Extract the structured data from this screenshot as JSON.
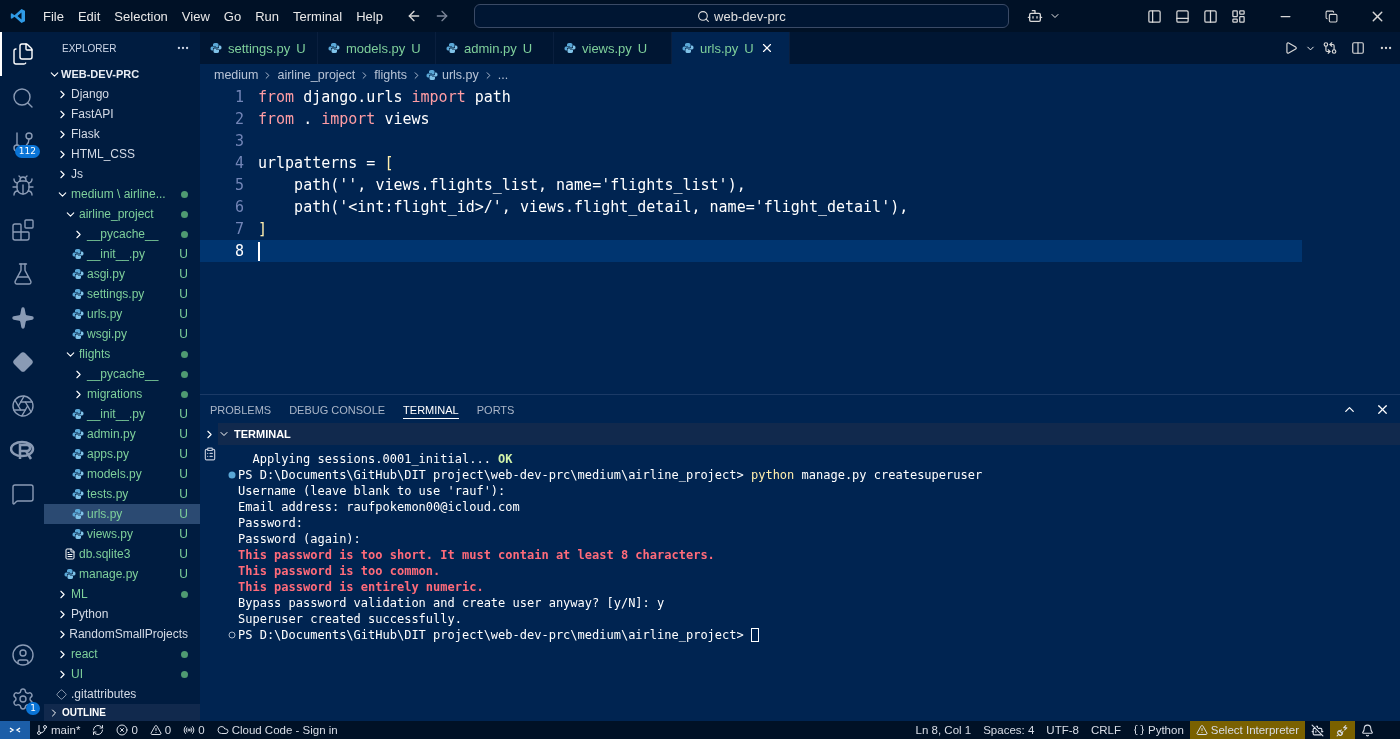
{
  "title_bar": {
    "menu": [
      "File",
      "Edit",
      "Selection",
      "View",
      "Go",
      "Run",
      "Terminal",
      "Help"
    ],
    "search": {
      "value": "web-dev-prc"
    }
  },
  "activity_bar": {
    "items": [
      {
        "kind": "files",
        "selected": true
      },
      {
        "kind": "search",
        "selected": false
      },
      {
        "kind": "source-control",
        "selected": false,
        "badge": "112"
      },
      {
        "kind": "run",
        "selected": false
      },
      {
        "kind": "extensions",
        "selected": false
      },
      {
        "kind": "testing",
        "selected": false
      },
      {
        "kind": "sparkle",
        "selected": false
      },
      {
        "kind": "diamonds",
        "selected": false
      },
      {
        "kind": "aperture",
        "selected": false
      },
      {
        "kind": "r",
        "selected": false
      },
      {
        "kind": "chat",
        "selected": false
      }
    ],
    "bottom": [
      {
        "kind": "account"
      },
      {
        "kind": "settings",
        "badge": "1"
      }
    ]
  },
  "explorer": {
    "title": "EXPLORER",
    "root": "WEB-DEV-PRC",
    "tree": [
      {
        "name": "Django",
        "kind": "folder",
        "expanded": false,
        "dot": false,
        "selected": false
      },
      {
        "name": "FastAPI",
        "kind": "folder",
        "expanded": false,
        "dot": false,
        "selected": false
      },
      {
        "name": "Flask",
        "kind": "folder",
        "expanded": false,
        "dot": false,
        "selected": false
      },
      {
        "name": "HTML_CSS",
        "kind": "folder",
        "expanded": false,
        "dot": false,
        "selected": false
      },
      {
        "name": "Js",
        "kind": "folder",
        "expanded": false,
        "dot": false,
        "selected": false
      },
      {
        "name": "medium \\ airline...",
        "kind": "folder",
        "expanded": true,
        "dot": true,
        "selected": false,
        "children": [
          {
            "name": "airline_project",
            "kind": "folder",
            "expanded": true,
            "dot": true,
            "selected": false,
            "children": [
              {
                "name": "__pycache__",
                "kind": "folder",
                "expanded": false,
                "dot": true,
                "selected": false
              },
              {
                "name": "__init__.py",
                "kind": "python",
                "git": "U",
                "selected": false
              },
              {
                "name": "asgi.py",
                "kind": "python",
                "git": "U",
                "selected": false
              },
              {
                "name": "settings.py",
                "kind": "python",
                "git": "U",
                "selected": false
              },
              {
                "name": "urls.py",
                "kind": "python",
                "git": "U",
                "selected": false
              },
              {
                "name": "wsgi.py",
                "kind": "python",
                "git": "U",
                "selected": false
              }
            ]
          },
          {
            "name": "flights",
            "kind": "folder",
            "expanded": true,
            "dot": true,
            "selected": false,
            "children": [
              {
                "name": "__pycache__",
                "kind": "folder",
                "expanded": false,
                "dot": true,
                "selected": false
              },
              {
                "name": "migrations",
                "kind": "folder",
                "expanded": false,
                "dot": true,
                "selected": false
              },
              {
                "name": "__init__.py",
                "kind": "python",
                "git": "U",
                "selected": false
              },
              {
                "name": "admin.py",
                "kind": "python",
                "git": "U",
                "selected": false
              },
              {
                "name": "apps.py",
                "kind": "python",
                "git": "U",
                "selected": false
              },
              {
                "name": "models.py",
                "kind": "python",
                "git": "U",
                "selected": false
              },
              {
                "name": "tests.py",
                "kind": "python",
                "git": "U",
                "selected": false
              },
              {
                "name": "urls.py",
                "kind": "python",
                "git": "U",
                "selected": true
              },
              {
                "name": "views.py",
                "kind": "python",
                "git": "U",
                "selected": false
              }
            ]
          },
          {
            "name": "db.sqlite3",
            "kind": "text",
            "git": "U",
            "selected": false
          },
          {
            "name": "manage.py",
            "kind": "python",
            "git": "U",
            "selected": false
          }
        ]
      },
      {
        "name": "ML",
        "kind": "folder",
        "expanded": false,
        "dot": true,
        "selected": false
      },
      {
        "name": "Python",
        "kind": "folder",
        "expanded": false,
        "dot": false,
        "selected": false
      },
      {
        "name": "RandomSmallProjects",
        "kind": "folder",
        "expanded": false,
        "dot": false,
        "selected": false
      },
      {
        "name": "react",
        "kind": "folder",
        "expanded": false,
        "dot": true,
        "selected": false
      },
      {
        "name": "UI",
        "kind": "folder",
        "expanded": false,
        "dot": true,
        "selected": false
      },
      {
        "name": ".gitattributes",
        "kind": "git-file",
        "selected": false
      }
    ],
    "outline": "OUTLINE"
  },
  "tabs": [
    {
      "label": "settings.py",
      "git": "U",
      "selected": false
    },
    {
      "label": "models.py",
      "git": "U",
      "selected": false
    },
    {
      "label": "admin.py",
      "git": "U",
      "selected": false
    },
    {
      "label": "views.py",
      "git": "U",
      "selected": false
    },
    {
      "label": "urls.py",
      "git": "U",
      "selected": true
    }
  ],
  "breadcrumb": [
    "medium",
    "airline_project",
    "flights",
    "urls.py",
    "..."
  ],
  "code": [
    {
      "number": "1",
      "current": false,
      "tokens": [
        {
          "text": "from",
          "kind": "keyword"
        },
        {
          "text": " django.urls ",
          "kind": "plain"
        },
        {
          "text": "import",
          "kind": "keyword"
        },
        {
          "text": " path",
          "kind": "plain"
        }
      ]
    },
    {
      "number": "2",
      "current": false,
      "tokens": [
        {
          "text": "from",
          "kind": "keyword"
        },
        {
          "text": " . ",
          "kind": "plain"
        },
        {
          "text": "import",
          "kind": "keyword"
        },
        {
          "text": " views",
          "kind": "plain"
        }
      ]
    },
    {
      "number": "3",
      "current": false
    },
    {
      "number": "4",
      "current": false,
      "tokens": [
        {
          "text": "urlpatterns = ",
          "kind": "plain"
        },
        {
          "text": "[",
          "kind": "bracket"
        }
      ]
    },
    {
      "number": "5",
      "current": false,
      "tokens": [
        {
          "text": "    path(",
          "kind": "plain"
        },
        {
          "text": "''",
          "kind": "string"
        },
        {
          "text": ", views.flights_list, name=",
          "kind": "plain"
        },
        {
          "text": "'flights_list'",
          "kind": "string"
        },
        {
          "text": "),",
          "kind": "plain"
        }
      ]
    },
    {
      "number": "6",
      "current": false,
      "tokens": [
        {
          "text": "    path(",
          "kind": "plain"
        },
        {
          "text": "'<int:flight_id>/'",
          "kind": "string"
        },
        {
          "text": ", views.flight_detail, name=",
          "kind": "plain"
        },
        {
          "text": "'flight_detail'",
          "kind": "string"
        },
        {
          "text": "),",
          "kind": "plain"
        }
      ]
    },
    {
      "number": "7",
      "current": false,
      "tokens": [
        {
          "text": "]",
          "kind": "bracket"
        }
      ]
    },
    {
      "number": "8",
      "current": true
    }
  ],
  "panel": {
    "tabs": [
      {
        "label": "PROBLEMS",
        "selected": false
      },
      {
        "label": "DEBUG CONSOLE",
        "selected": false
      },
      {
        "label": "TERMINAL",
        "selected": true
      },
      {
        "label": "PORTS",
        "selected": false
      }
    ],
    "terminal_title": "TERMINAL",
    "lines": [
      {
        "kind": "output",
        "segments": [
          {
            "text": "  Applying sessions.0001_initial... ",
            "kind": "plain"
          },
          {
            "text": "OK",
            "kind": "ok"
          }
        ]
      },
      {
        "kind": "command",
        "finished": true,
        "segments": [
          {
            "text": "PS D:\\Documents\\GitHub\\DIT project\\web-dev-prc\\medium\\airline_project> ",
            "kind": "plain"
          },
          {
            "text": "python",
            "kind": "command"
          },
          {
            "text": " manage.py createsuperuser",
            "kind": "plain"
          }
        ]
      },
      {
        "kind": "output",
        "segments": [
          {
            "text": "Username (leave blank to use 'rauf'):",
            "kind": "plain"
          }
        ]
      },
      {
        "kind": "output",
        "segments": [
          {
            "text": "Email address: raufpokemon00@icloud.com",
            "kind": "plain"
          }
        ]
      },
      {
        "kind": "output",
        "segments": [
          {
            "text": "Password:",
            "kind": "plain"
          }
        ]
      },
      {
        "kind": "output",
        "segments": [
          {
            "text": "Password (again):",
            "kind": "plain"
          }
        ]
      },
      {
        "kind": "output",
        "segments": [
          {
            "text": "This password is too short. It must contain at least 8 characters.",
            "kind": "error"
          }
        ]
      },
      {
        "kind": "output",
        "segments": [
          {
            "text": "This password is too common.",
            "kind": "error"
          }
        ]
      },
      {
        "kind": "output",
        "segments": [
          {
            "text": "This password is entirely numeric.",
            "kind": "error"
          }
        ]
      },
      {
        "kind": "output",
        "segments": [
          {
            "text": "Bypass password validation and create user anyway? [y/N]: y",
            "kind": "plain"
          }
        ]
      },
      {
        "kind": "output",
        "segments": [
          {
            "text": "Superuser created successfully.",
            "kind": "plain"
          }
        ]
      },
      {
        "kind": "command",
        "finished": false,
        "cursor": true,
        "segments": [
          {
            "text": "PS D:\\Documents\\GitHub\\DIT project\\web-dev-prc\\medium\\airline_project> ",
            "kind": "plain"
          }
        ]
      }
    ]
  },
  "status_bar": {
    "left": [
      {
        "kind": "branch",
        "text": "main*"
      },
      {
        "kind": "sync"
      },
      {
        "kind": "errors",
        "text": "0"
      },
      {
        "kind": "warnings",
        "text": "0"
      },
      {
        "kind": "ports",
        "text": "0"
      },
      {
        "kind": "cloud",
        "text": "Cloud Code - Sign in"
      }
    ],
    "right": [
      {
        "kind": "plain",
        "text": "Ln 8, Col 1"
      },
      {
        "kind": "plain",
        "text": "Spaces: 4"
      },
      {
        "kind": "plain",
        "text": "UTF-8"
      },
      {
        "kind": "plain",
        "text": "CRLF"
      },
      {
        "kind": "language",
        "text": "Python"
      },
      {
        "kind": "warning",
        "text": "Select Interpreter"
      },
      {
        "kind": "copilot-off"
      },
      {
        "kind": "highlight"
      },
      {
        "kind": "bell"
      }
    ]
  }
}
